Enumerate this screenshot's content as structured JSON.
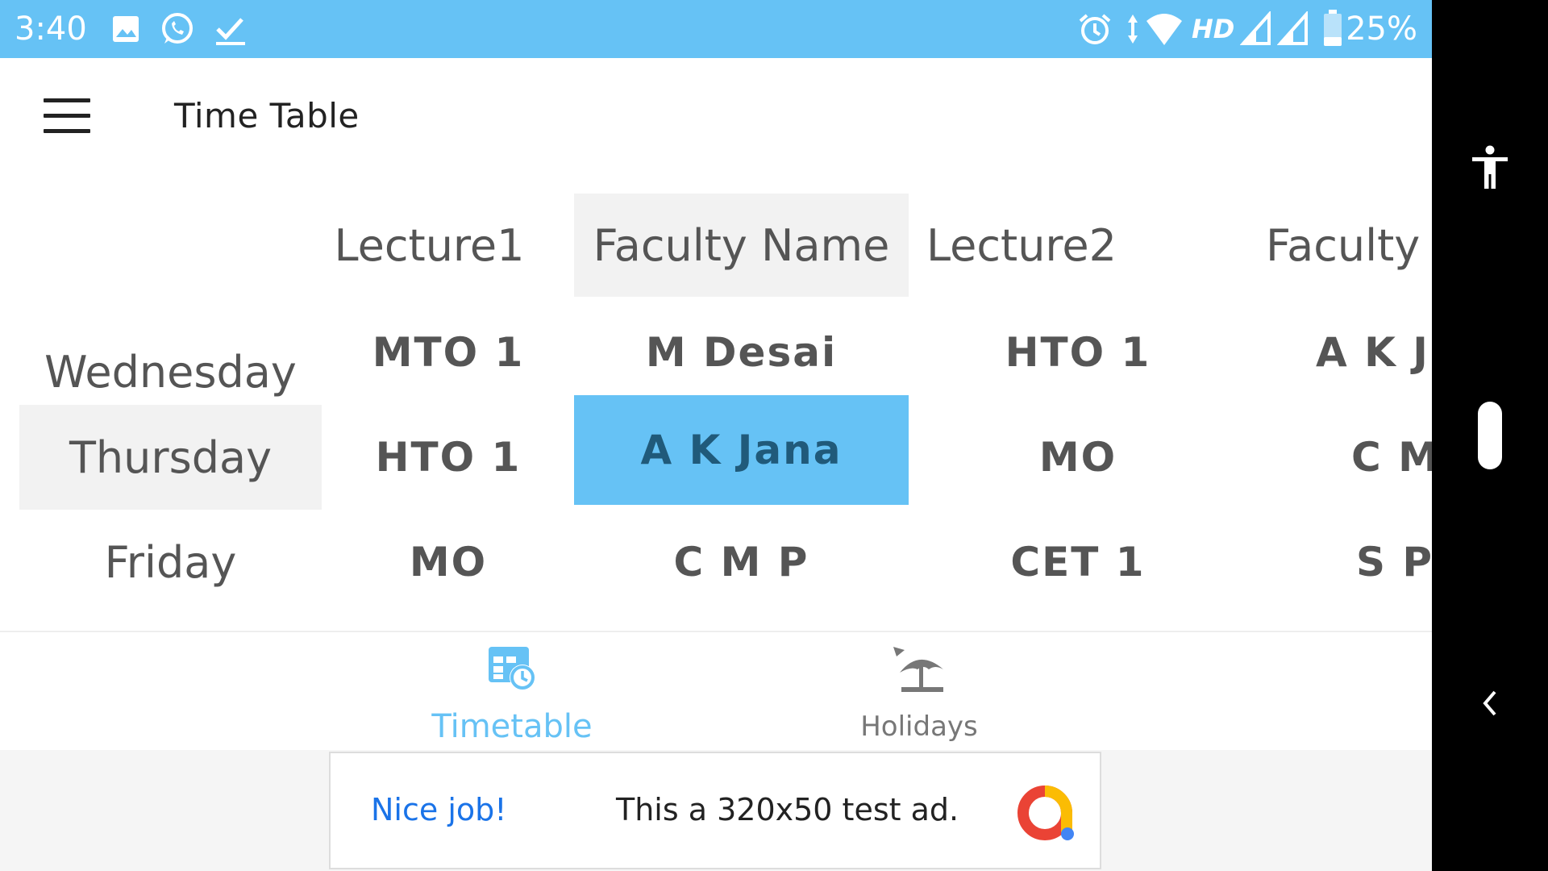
{
  "status_bar": {
    "time": "3:40",
    "hd_label": "HD",
    "battery_percent": "25%",
    "icons": [
      "image-icon",
      "whatsapp-icon",
      "download-done-icon",
      "alarm-icon",
      "data-arrows-icon",
      "wifi-icon",
      "signal-icon",
      "signal-icon",
      "battery-icon"
    ],
    "background_color": "#66c2f5"
  },
  "app_bar": {
    "title": "Time Table"
  },
  "timetable": {
    "columns": [
      "Lecture1",
      "Faculty Name",
      "Lecture2",
      "Faculty"
    ],
    "rows": [
      {
        "day": "Wednesday",
        "lecture1": "MTO 1",
        "faculty1": "M Desai",
        "lecture2": "HTO 1",
        "faculty2": "A K J"
      },
      {
        "day": "Thursday",
        "lecture1": "HTO 1",
        "faculty1": "A K Jana",
        "lecture2": "MO",
        "faculty2": "C M"
      },
      {
        "day": "Friday",
        "lecture1": "MO",
        "faculty1": "C M P",
        "lecture2": "CET 1",
        "faculty2": "S P"
      }
    ],
    "selected_cell": {
      "row": "Thursday",
      "column": "Faculty Name"
    },
    "highlight_color": "#66c2f5",
    "shade_color": "#f2f2f2"
  },
  "bottom_nav": {
    "items": [
      {
        "label": "Timetable",
        "icon": "timetable-icon",
        "active": true
      },
      {
        "label": "Holidays",
        "icon": "beach-umbrella-icon",
        "active": false
      }
    ],
    "active_color": "#66c2f5",
    "inactive_color": "#777777"
  },
  "ad": {
    "nice_text": "Nice job!",
    "body_text": "This a 320x50 test ad.",
    "logo": "ad-logo-icon"
  },
  "system_nav": {
    "icons": [
      "accessibility-icon",
      "home-pill",
      "back-icon"
    ]
  }
}
